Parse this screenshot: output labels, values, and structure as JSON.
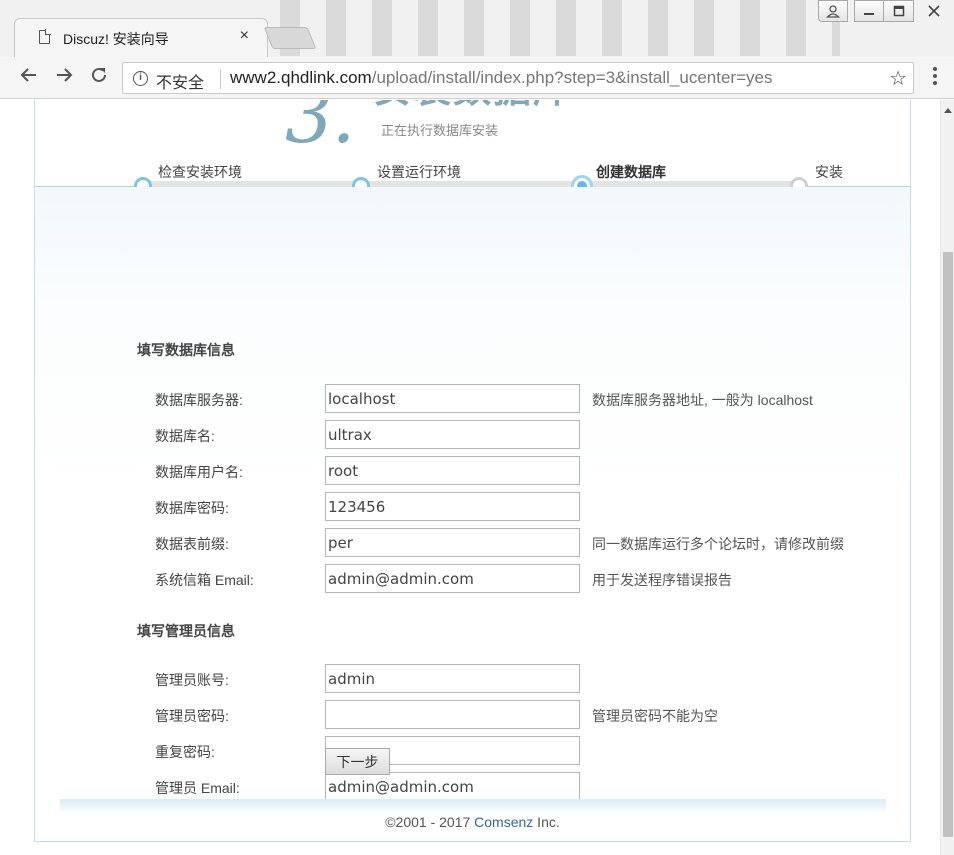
{
  "browser": {
    "tab_title": "Discuz! 安装向导",
    "tab_close": "×",
    "security_label": "不安全",
    "url_host": "www2.qhdlink.com",
    "url_path": "/upload/install/index.php?step=3&install_ucenter=yes",
    "icons": [
      "page-icon",
      "close-icon",
      "back-icon",
      "forward-icon",
      "reload-icon",
      "info-icon",
      "star-icon",
      "menu-icon",
      "user-icon",
      "minimize-icon",
      "maximize-icon"
    ]
  },
  "header": {
    "step_number": "3.",
    "step_title": "安装数据库",
    "step_subtitle": "正在执行数据库安装"
  },
  "steps": [
    {
      "label": "检查安装环境",
      "state": "done"
    },
    {
      "label": "设置运行环境",
      "state": "done"
    },
    {
      "label": "创建数据库",
      "state": "current"
    },
    {
      "label": "安装",
      "state": "todo"
    }
  ],
  "db_section": {
    "title": "填写数据库信息",
    "fields": [
      {
        "label": "数据库服务器:",
        "value": "localhost",
        "hint": "数据库服务器地址, 一般为 localhost"
      },
      {
        "label": "数据库名:",
        "value": "ultrax",
        "hint": ""
      },
      {
        "label": "数据库用户名:",
        "value": "root",
        "hint": ""
      },
      {
        "label": "数据库密码:",
        "value": "123456",
        "hint": ""
      },
      {
        "label": "数据表前缀:",
        "value": "per",
        "hint": "同一数据库运行多个论坛时，请修改前缀"
      },
      {
        "label": "系统信箱 Email:",
        "value": "admin@admin.com",
        "hint": "用于发送程序错误报告"
      }
    ]
  },
  "admin_section": {
    "title": "填写管理员信息",
    "fields": [
      {
        "label": "管理员账号:",
        "value": "admin",
        "hint": ""
      },
      {
        "label": "管理员密码:",
        "value": "",
        "hint": "管理员密码不能为空"
      },
      {
        "label": "重复密码:",
        "value": "",
        "hint": ""
      },
      {
        "label": "管理员 Email:",
        "value": "admin@admin.com",
        "hint": ""
      }
    ]
  },
  "next_button": "下一步",
  "footer": {
    "prefix": "©2001 - 2017 ",
    "link": "Comsenz",
    "suffix": " Inc."
  },
  "colors": {
    "accent": "#7fa8bb",
    "step_blue": "#64b8e4",
    "link": "#336699"
  }
}
